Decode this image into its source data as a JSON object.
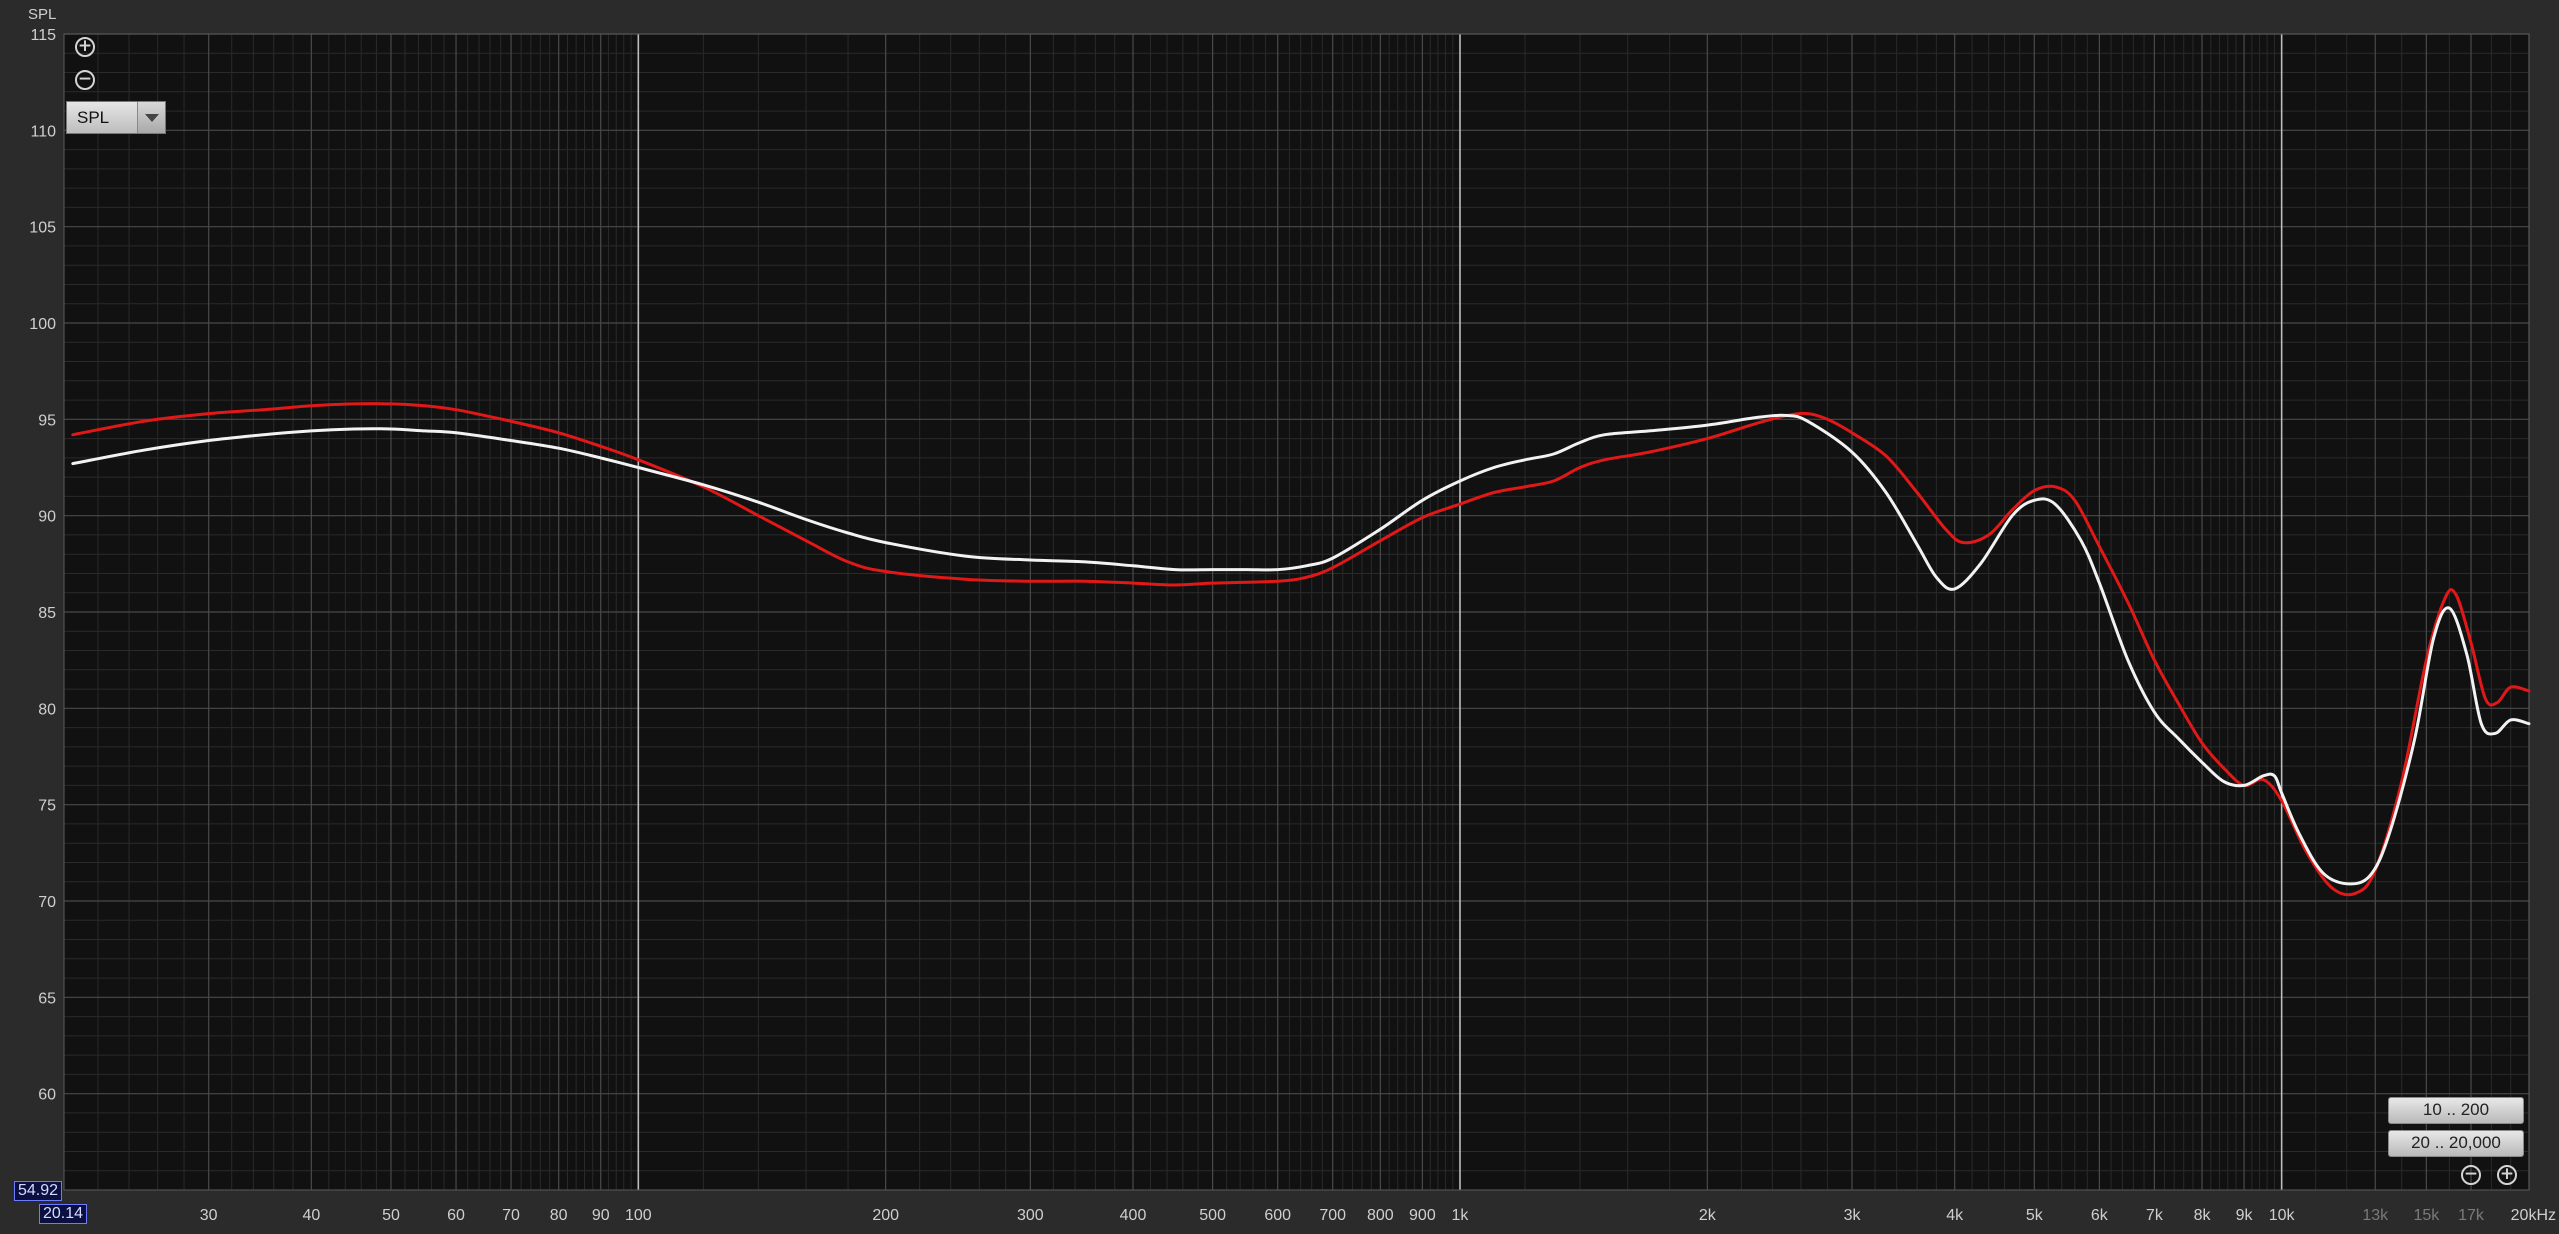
{
  "chart_data": {
    "type": "line",
    "ylabel": "SPL",
    "x_scale": "log",
    "xlim": [
      20,
      20000
    ],
    "ylim": [
      55,
      115
    ],
    "y_ticks": [
      60,
      65,
      70,
      75,
      80,
      85,
      90,
      95,
      100,
      105,
      110,
      115
    ],
    "x_ticks": [
      {
        "v": 30,
        "label": "30"
      },
      {
        "v": 40,
        "label": "40"
      },
      {
        "v": 50,
        "label": "50"
      },
      {
        "v": 60,
        "label": "60"
      },
      {
        "v": 70,
        "label": "70"
      },
      {
        "v": 80,
        "label": "80"
      },
      {
        "v": 90,
        "label": "90"
      },
      {
        "v": 100,
        "label": "100"
      },
      {
        "v": 200,
        "label": "200"
      },
      {
        "v": 300,
        "label": "300"
      },
      {
        "v": 400,
        "label": "400"
      },
      {
        "v": 500,
        "label": "500"
      },
      {
        "v": 600,
        "label": "600"
      },
      {
        "v": 700,
        "label": "700"
      },
      {
        "v": 800,
        "label": "800"
      },
      {
        "v": 900,
        "label": "900"
      },
      {
        "v": 1000,
        "label": "1k"
      },
      {
        "v": 2000,
        "label": "2k"
      },
      {
        "v": 3000,
        "label": "3k"
      },
      {
        "v": 4000,
        "label": "4k"
      },
      {
        "v": 5000,
        "label": "5k"
      },
      {
        "v": 6000,
        "label": "6k"
      },
      {
        "v": 7000,
        "label": "7k"
      },
      {
        "v": 8000,
        "label": "8k"
      },
      {
        "v": 9000,
        "label": "9k"
      },
      {
        "v": 10000,
        "label": "10k"
      },
      {
        "v": 13000,
        "label": "13k",
        "dim": true
      },
      {
        "v": 15000,
        "label": "15k",
        "dim": true
      },
      {
        "v": 17000,
        "label": "17k",
        "dim": true
      },
      {
        "v": 20000,
        "label": "20kHz"
      }
    ],
    "grid": true,
    "series": [
      {
        "color": "#e01818",
        "points": [
          [
            20.5,
            94.2
          ],
          [
            25,
            94.9
          ],
          [
            30,
            95.3
          ],
          [
            35,
            95.5
          ],
          [
            40,
            95.7
          ],
          [
            45,
            95.8
          ],
          [
            50,
            95.8
          ],
          [
            55,
            95.7
          ],
          [
            60,
            95.5
          ],
          [
            65,
            95.2
          ],
          [
            70,
            94.9
          ],
          [
            80,
            94.3
          ],
          [
            90,
            93.6
          ],
          [
            100,
            92.9
          ],
          [
            120,
            91.5
          ],
          [
            140,
            90.0
          ],
          [
            160,
            88.7
          ],
          [
            180,
            87.6
          ],
          [
            200,
            87.1
          ],
          [
            250,
            86.7
          ],
          [
            300,
            86.6
          ],
          [
            350,
            86.6
          ],
          [
            400,
            86.5
          ],
          [
            450,
            86.4
          ],
          [
            500,
            86.5
          ],
          [
            600,
            86.6
          ],
          [
            650,
            86.8
          ],
          [
            700,
            87.3
          ],
          [
            800,
            88.7
          ],
          [
            900,
            89.9
          ],
          [
            1000,
            90.6
          ],
          [
            1100,
            91.2
          ],
          [
            1200,
            91.5
          ],
          [
            1300,
            91.8
          ],
          [
            1400,
            92.5
          ],
          [
            1500,
            92.9
          ],
          [
            1700,
            93.3
          ],
          [
            2000,
            94.0
          ],
          [
            2300,
            94.8
          ],
          [
            2500,
            95.2
          ],
          [
            2650,
            95.3
          ],
          [
            2800,
            95.0
          ],
          [
            3000,
            94.3
          ],
          [
            3300,
            93.1
          ],
          [
            3600,
            91.2
          ],
          [
            3900,
            89.3
          ],
          [
            4100,
            88.6
          ],
          [
            4400,
            89.0
          ],
          [
            4700,
            90.3
          ],
          [
            5000,
            91.3
          ],
          [
            5300,
            91.5
          ],
          [
            5600,
            90.8
          ],
          [
            6000,
            88.4
          ],
          [
            6500,
            85.5
          ],
          [
            7000,
            82.5
          ],
          [
            7500,
            80.2
          ],
          [
            8000,
            78.2
          ],
          [
            8500,
            76.9
          ],
          [
            9000,
            76.0
          ],
          [
            9500,
            76.3
          ],
          [
            10000,
            75.2
          ],
          [
            10700,
            72.6
          ],
          [
            11500,
            70.7
          ],
          [
            12300,
            70.4
          ],
          [
            13000,
            71.6
          ],
          [
            14000,
            76.2
          ],
          [
            15000,
            82.5
          ],
          [
            15800,
            85.7
          ],
          [
            16300,
            85.9
          ],
          [
            17000,
            83.4
          ],
          [
            17700,
            80.5
          ],
          [
            18300,
            80.3
          ],
          [
            19000,
            81.1
          ],
          [
            20000,
            80.9
          ]
        ]
      },
      {
        "color": "#f2f2f2",
        "points": [
          [
            20.5,
            92.7
          ],
          [
            25,
            93.4
          ],
          [
            30,
            93.9
          ],
          [
            35,
            94.2
          ],
          [
            40,
            94.4
          ],
          [
            45,
            94.5
          ],
          [
            50,
            94.5
          ],
          [
            55,
            94.4
          ],
          [
            60,
            94.3
          ],
          [
            70,
            93.9
          ],
          [
            80,
            93.5
          ],
          [
            90,
            93.0
          ],
          [
            100,
            92.5
          ],
          [
            120,
            91.6
          ],
          [
            140,
            90.7
          ],
          [
            160,
            89.8
          ],
          [
            180,
            89.1
          ],
          [
            200,
            88.6
          ],
          [
            250,
            87.9
          ],
          [
            300,
            87.7
          ],
          [
            350,
            87.6
          ],
          [
            400,
            87.4
          ],
          [
            450,
            87.2
          ],
          [
            500,
            87.2
          ],
          [
            550,
            87.2
          ],
          [
            600,
            87.2
          ],
          [
            650,
            87.4
          ],
          [
            700,
            87.8
          ],
          [
            800,
            89.3
          ],
          [
            900,
            90.8
          ],
          [
            1000,
            91.8
          ],
          [
            1100,
            92.5
          ],
          [
            1200,
            92.9
          ],
          [
            1300,
            93.2
          ],
          [
            1400,
            93.8
          ],
          [
            1500,
            94.2
          ],
          [
            1700,
            94.4
          ],
          [
            2000,
            94.7
          ],
          [
            2300,
            95.1
          ],
          [
            2500,
            95.2
          ],
          [
            2650,
            94.9
          ],
          [
            3000,
            93.3
          ],
          [
            3300,
            91.2
          ],
          [
            3600,
            88.5
          ],
          [
            3800,
            86.8
          ],
          [
            4000,
            86.2
          ],
          [
            4300,
            87.5
          ],
          [
            4700,
            90.0
          ],
          [
            5000,
            90.8
          ],
          [
            5300,
            90.6
          ],
          [
            5700,
            88.7
          ],
          [
            6000,
            86.5
          ],
          [
            6500,
            82.5
          ],
          [
            7000,
            79.8
          ],
          [
            7500,
            78.4
          ],
          [
            8000,
            77.2
          ],
          [
            8500,
            76.2
          ],
          [
            9000,
            76.0
          ],
          [
            9500,
            76.5
          ],
          [
            9800,
            76.5
          ],
          [
            10000,
            75.6
          ],
          [
            10500,
            73.5
          ],
          [
            11200,
            71.5
          ],
          [
            12000,
            70.9
          ],
          [
            12800,
            71.3
          ],
          [
            13500,
            73.4
          ],
          [
            14500,
            78.3
          ],
          [
            15300,
            83.6
          ],
          [
            16000,
            85.2
          ],
          [
            16800,
            82.8
          ],
          [
            17500,
            79.2
          ],
          [
            18200,
            78.7
          ],
          [
            19000,
            79.4
          ],
          [
            20000,
            79.2
          ]
        ]
      }
    ]
  },
  "controls": {
    "zoom_in_symbol": "+",
    "zoom_out_symbol": "−",
    "y_metric_select": "SPL",
    "range_button_1": "10 .. 200",
    "range_button_2": "20 .. 20,000"
  },
  "cursor": {
    "y_value": "54.92",
    "x_value": "20.14"
  },
  "colors": {
    "plot_background": "#111111",
    "frame_background": "#2b2b2b",
    "grid_major": "#4a4a4a",
    "grid_minor": "#2a2a2a",
    "label_text": "#cfcfcf"
  }
}
